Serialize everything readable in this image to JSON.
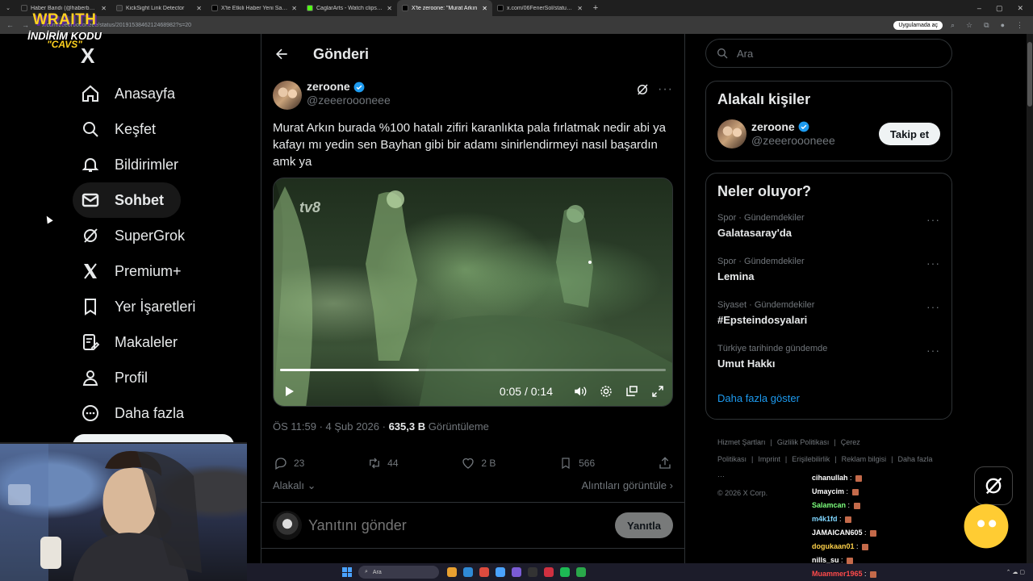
{
  "browser": {
    "tabs": [
      {
        "title": "Haber Bandı (@haberbandicom",
        "color": "#1d1d1d",
        "active": false
      },
      {
        "title": "KickSight Link Detector",
        "color": "#2f2f2f",
        "active": false
      },
      {
        "title": "X'te Etkili Haber Yeni Sayfa: \"SO",
        "color": "#000000",
        "active": false
      },
      {
        "title": "CaglarArts - Watch clips on Kic",
        "color": "#53fc18",
        "active": false
      },
      {
        "title": "X'te zeroone: \"Murat Arkın",
        "color": "#000000",
        "active": true
      },
      {
        "title": "x.com/06FenerSol/status/2019",
        "color": "#000000",
        "active": false
      }
    ],
    "url": "x.com/zeeerooooneee/status/2019153846212468982?s=20",
    "open_in_app": "Uygulamada aç"
  },
  "promo": {
    "brand": "WRAITH",
    "code": "İNDİRİM KODU",
    "coupon": "\"CAVS\""
  },
  "nav": {
    "logo": "X",
    "items": [
      {
        "label": "Anasayfa",
        "icon": "home-icon"
      },
      {
        "label": "Keşfet",
        "icon": "search-icon"
      },
      {
        "label": "Bildirimler",
        "icon": "bell-icon"
      },
      {
        "label": "Sohbet",
        "icon": "mail-icon"
      },
      {
        "label": "SuperGrok",
        "icon": "grok-icon"
      },
      {
        "label": "Premium+",
        "icon": "x-logo-icon"
      },
      {
        "label": "Yer İşaretleri",
        "icon": "bookmark-icon"
      },
      {
        "label": "Makaleler",
        "icon": "article-icon"
      },
      {
        "label": "Profil",
        "icon": "person-icon"
      },
      {
        "label": "Daha fazla",
        "icon": "more-circle-icon"
      }
    ]
  },
  "main": {
    "title": "Gönderi",
    "post": {
      "author_name": "zeroone",
      "author_handle": "@zeeeroooneee",
      "text": "Murat Arkın burada %100 hatalı zifiri karanlıkta pala fırlatmak nedir abi ya kafayı mı yedin sen Bayhan gibi bir adamı sinirlendirmeyi nasıl başardın amk ya",
      "video": {
        "channel_logo": "tv8",
        "time": "0:05 / 0:14",
        "progress": 0.36
      },
      "timestamp": "ÖS 11:59 · 4 Şub 2026 · ",
      "views_count": "635,3 B",
      "views_label": " Görüntüleme",
      "stats": {
        "replies": "23",
        "reposts": "44",
        "likes": "2 B",
        "bookmarks": "566"
      },
      "related_label": "Alakalı",
      "quotes_label": "Alıntıları görüntüle"
    },
    "reply": {
      "placeholder": "Yanıtını gönder",
      "button": "Yanıtla"
    }
  },
  "right": {
    "search_placeholder": "Ara",
    "related": {
      "title": "Alakalı kişiler",
      "name": "zeroone",
      "handle": "@zeeeroooneee",
      "follow": "Takip et"
    },
    "trends": {
      "title": "Neler oluyor?",
      "items": [
        {
          "context": "Spor · Gündemdekiler",
          "name": "Galatasaray'da"
        },
        {
          "context": "Spor · Gündemdekiler",
          "name": "Lemina"
        },
        {
          "context": "Siyaset · Gündemdekiler",
          "name": "#Epsteindosyalari"
        },
        {
          "context": "Türkiye tarihinde gündemde",
          "name": "Umut Hakkı"
        }
      ],
      "show_more": "Daha fazla göster"
    },
    "footer": {
      "links": [
        "Hizmet Şartları",
        "|",
        "Gizlilik Politikası",
        "|",
        "Çerez Politikası",
        "|",
        "Imprint",
        "|",
        "Erişilebilirlik",
        "|",
        "Reklam bilgisi",
        "|",
        "Daha fazla ···"
      ],
      "copyright": "© 2026 X Corp."
    }
  },
  "chat": [
    {
      "user": "cihanullah",
      "color": "#ffffff"
    },
    {
      "user": "Umaycim",
      "color": "#ffffff"
    },
    {
      "user": "Salamcan",
      "color": "#7dff7d"
    },
    {
      "user": "m4k1fd",
      "color": "#7fd6ff"
    },
    {
      "user": "JAMAICAN605",
      "color": "#ffffff"
    },
    {
      "user": "dogukaan01",
      "color": "#ffd24a"
    },
    {
      "user": "nills_su",
      "color": "#ffffff"
    },
    {
      "user": "Muammer1965",
      "color": "#ff4a4a"
    }
  ],
  "taskbar": {
    "search": "Ara"
  }
}
